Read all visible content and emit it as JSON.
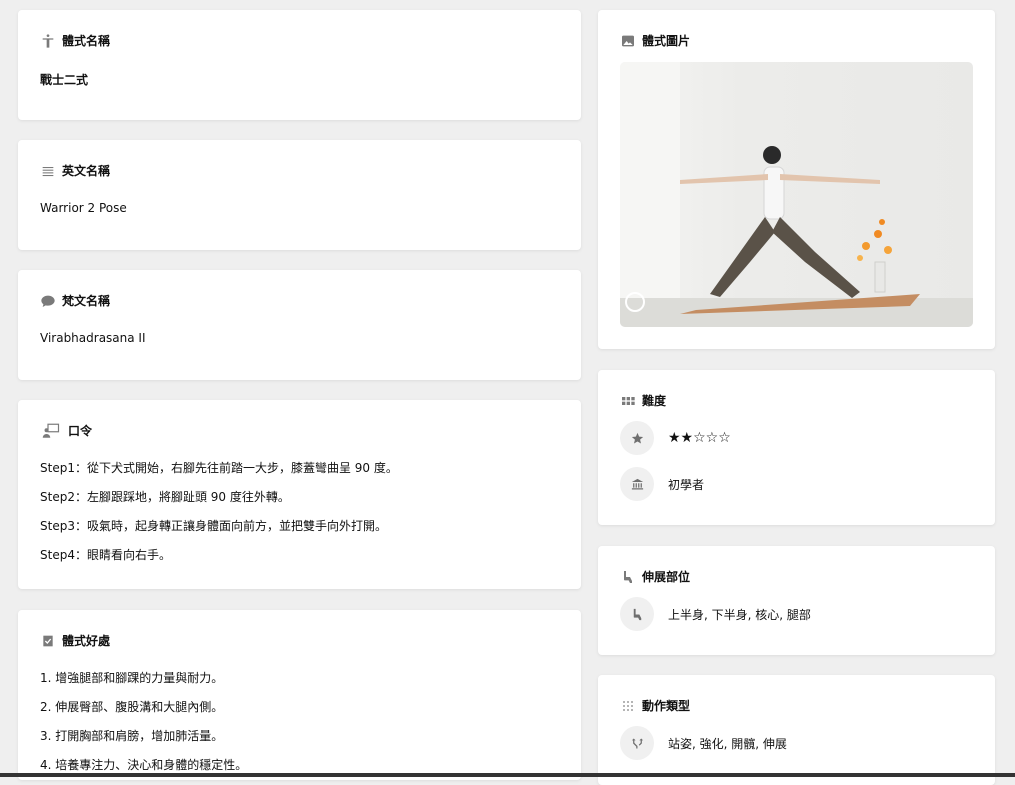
{
  "pose_name": {
    "title": "體式名稱",
    "value": "戰士二式"
  },
  "english_name": {
    "title": "英文名稱",
    "value": "Warrior 2 Pose"
  },
  "sanskrit_name": {
    "title": "梵文名稱",
    "value": "Virabhadrasana II"
  },
  "cues": {
    "title": "口令",
    "steps": [
      "Step1：從下犬式開始，右腳先往前踏一大步，膝蓋彎曲呈 90 度。",
      "Step2：左腳跟踩地，將腳趾頭 90 度往外轉。",
      "Step3：吸氣時，起身轉正讓身體面向前方，並把雙手向外打開。",
      "Step4：眼睛看向右手。"
    ]
  },
  "benefits": {
    "title": "體式好處",
    "items": [
      "1. 增強腿部和腳踝的力量與耐力。",
      "2. 伸展臀部、腹股溝和大腿內側。",
      "3. 打開胸部和肩膀，增加肺活量。",
      "4. 培養專注力、決心和身體的穩定性。"
    ]
  },
  "pose_image": {
    "title": "體式圖片"
  },
  "difficulty": {
    "title": "難度",
    "stars": "★★☆☆☆",
    "stars_value": 2,
    "stars_max": 5,
    "level": "初學者"
  },
  "stretch": {
    "title": "伸展部位",
    "value": "上半身, 下半身, 核心, 腿部"
  },
  "action_type": {
    "title": "動作類型",
    "value": "站姿, 強化, 開髖, 伸展"
  },
  "colors": {
    "page_bg": "#efefef",
    "card_bg": "#ffffff",
    "icon_gray": "#7a7a7a"
  }
}
